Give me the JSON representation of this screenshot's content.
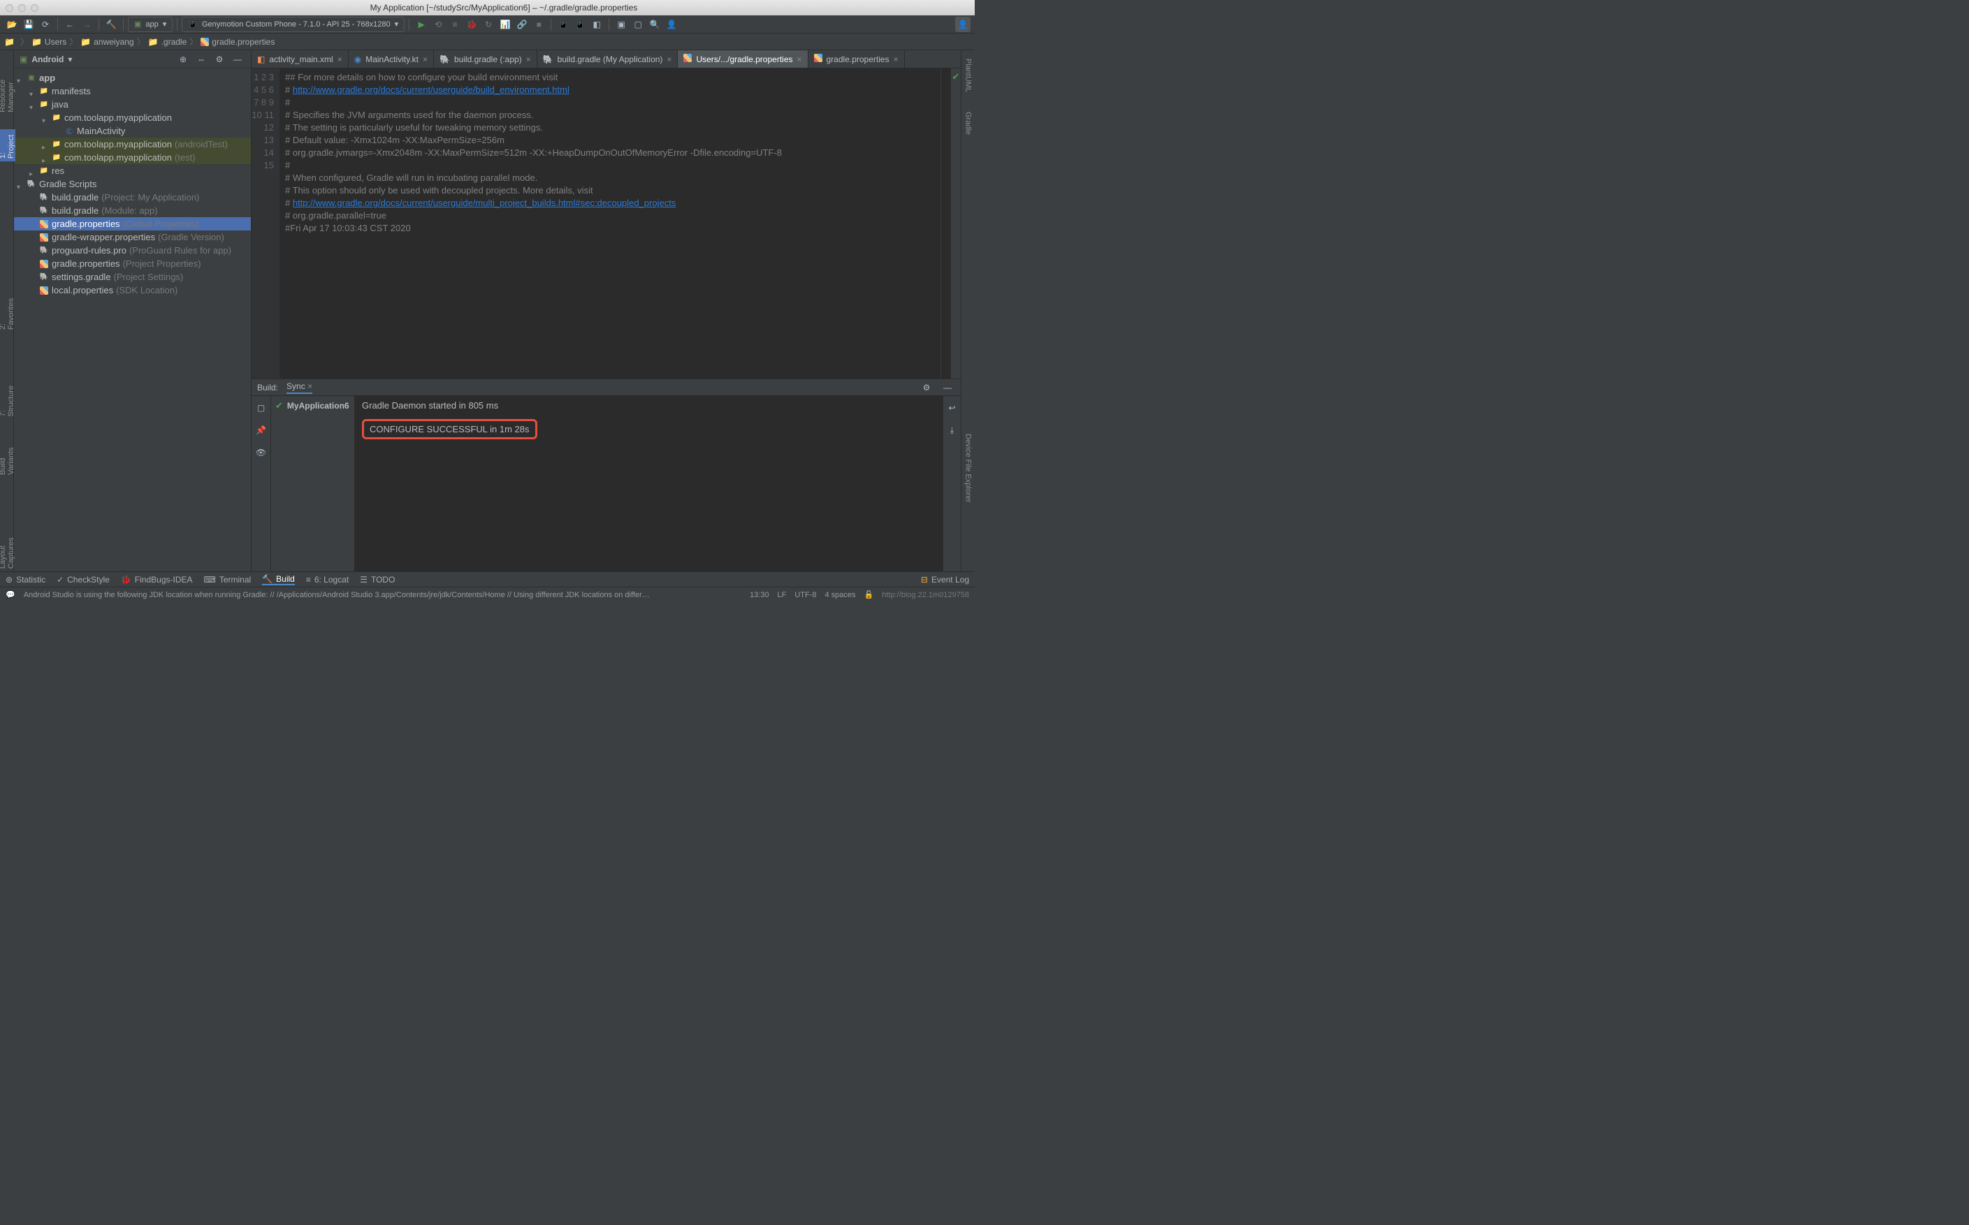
{
  "title": "My Application [~/studySrc/MyApplication6] – ~/.gradle/gradle.properties",
  "toolbar": {
    "config_selector": "app",
    "device_selector": "Genymotion Custom Phone - 7.1.0 - API 25 - 768x1280"
  },
  "breadcrumbs": [
    "",
    "Users",
    "anweiyang",
    ".gradle",
    "gradle.properties"
  ],
  "project": {
    "view_mode": "Android",
    "tree": [
      {
        "indent": 0,
        "arrow": "open",
        "icon": "module",
        "label": "app",
        "bold": true
      },
      {
        "indent": 1,
        "arrow": "open",
        "icon": "folder",
        "label": "manifests"
      },
      {
        "indent": 1,
        "arrow": "open",
        "icon": "folder",
        "label": "java"
      },
      {
        "indent": 2,
        "arrow": "open",
        "icon": "package",
        "label": "com.toolapp.myapplication"
      },
      {
        "indent": 3,
        "arrow": "none",
        "icon": "class",
        "label": "MainActivity"
      },
      {
        "indent": 2,
        "arrow": "closed",
        "icon": "package",
        "label": "com.toolapp.myapplication",
        "suffix": "(androidTest)",
        "hl": true
      },
      {
        "indent": 2,
        "arrow": "closed",
        "icon": "package",
        "label": "com.toolapp.myapplication",
        "suffix": "(test)",
        "hl": true
      },
      {
        "indent": 1,
        "arrow": "closed",
        "icon": "folder",
        "label": "res"
      },
      {
        "indent": 0,
        "arrow": "open",
        "icon": "gradle",
        "label": "Gradle Scripts"
      },
      {
        "indent": 1,
        "arrow": "none",
        "icon": "gradle-file",
        "label": "build.gradle",
        "suffix": "(Project: My Application)"
      },
      {
        "indent": 1,
        "arrow": "none",
        "icon": "gradle-file",
        "label": "build.gradle",
        "suffix": "(Module: app)"
      },
      {
        "indent": 1,
        "arrow": "none",
        "icon": "gprop",
        "label": "gradle.properties",
        "suffix": "(Global Properties)",
        "selected": true
      },
      {
        "indent": 1,
        "arrow": "none",
        "icon": "gprop",
        "label": "gradle-wrapper.properties",
        "suffix": "(Gradle Version)"
      },
      {
        "indent": 1,
        "arrow": "none",
        "icon": "gradle-file",
        "label": "proguard-rules.pro",
        "suffix": "(ProGuard Rules for app)"
      },
      {
        "indent": 1,
        "arrow": "none",
        "icon": "gprop",
        "label": "gradle.properties",
        "suffix": "(Project Properties)"
      },
      {
        "indent": 1,
        "arrow": "none",
        "icon": "gradle-file",
        "label": "settings.gradle",
        "suffix": "(Project Settings)"
      },
      {
        "indent": 1,
        "arrow": "none",
        "icon": "gprop",
        "label": "local.properties",
        "suffix": "(SDK Location)"
      }
    ]
  },
  "editor_tabs": [
    {
      "icon": "xml",
      "label": "activity_main.xml"
    },
    {
      "icon": "kt",
      "label": "MainActivity.kt"
    },
    {
      "icon": "gradle-file",
      "label": "build.gradle (:app)"
    },
    {
      "icon": "gradle-file",
      "label": "build.gradle (My Application)"
    },
    {
      "icon": "gprop",
      "label": "Users/.../gradle.properties",
      "active": true
    },
    {
      "icon": "gprop",
      "label": "gradle.properties"
    }
  ],
  "code": {
    "lines": 15,
    "l1": "## For more details on how to configure your build environment visit",
    "l2a": "# ",
    "l2b": "http://www.gradle.org/docs/current/userguide/build_environment.html",
    "l3": "#",
    "l4": "# Specifies the JVM arguments used for the daemon process.",
    "l5": "# The setting is particularly useful for tweaking memory settings.",
    "l6": "# Default value: -Xmx1024m -XX:MaxPermSize=256m",
    "l7": "# org.gradle.jvmargs=-Xmx2048m -XX:MaxPermSize=512m -XX:+HeapDumpOnOutOfMemoryError -Dfile.encoding=UTF-8",
    "l8": "#",
    "l9": "# When configured, Gradle will run in incubating parallel mode.",
    "l10": "# This option should only be used with decoupled projects. More details, visit",
    "l11a": "# ",
    "l11b": "http://www.gradle.org/docs/current/userguide/multi_project_builds.html#sec:decoupled_projects",
    "l12": "# org.gradle.parallel=true",
    "l13": "#Fri Apr 17 10:03:43 CST 2020"
  },
  "build": {
    "head_label": "Build:",
    "sync_label": "Sync",
    "tree_item": "MyApplication6",
    "out_line1": "Gradle Daemon started in 805 ms",
    "out_line2": "CONFIGURE SUCCESSFUL in 1m 28s"
  },
  "left_tools": [
    "Resource Manager",
    "1: Project",
    "2: Favorites",
    "7: Structure",
    "Build Variants",
    "Layout Captures"
  ],
  "right_tools": [
    "PlantUML",
    "Gradle",
    "Device File Explorer"
  ],
  "bottom_tools": [
    {
      "icon": "⊚",
      "label": "Statistic"
    },
    {
      "icon": "✓",
      "label": "CheckStyle"
    },
    {
      "icon": "🐞",
      "label": "FindBugs-IDEA"
    },
    {
      "icon": "⌨",
      "label": "Terminal"
    },
    {
      "icon": "🔨",
      "label": "Build",
      "active": true
    },
    {
      "icon": "≡",
      "label": "6: Logcat"
    },
    {
      "icon": "☰",
      "label": "TODO"
    }
  ],
  "event_log": "Event Log",
  "status": {
    "msg": "Android Studio is using the following JDK location when running Gradle: // /Applications/Android Studio 3.app/Contents/jre/jdk/Contents/Home // Using different JDK locations on different processes might... (moments ago)",
    "pos": "13:30",
    "line_sep": "LF",
    "encoding": "UTF-8",
    "indent": "4 spaces",
    "brand": "http://blog.22.1m0129758"
  }
}
